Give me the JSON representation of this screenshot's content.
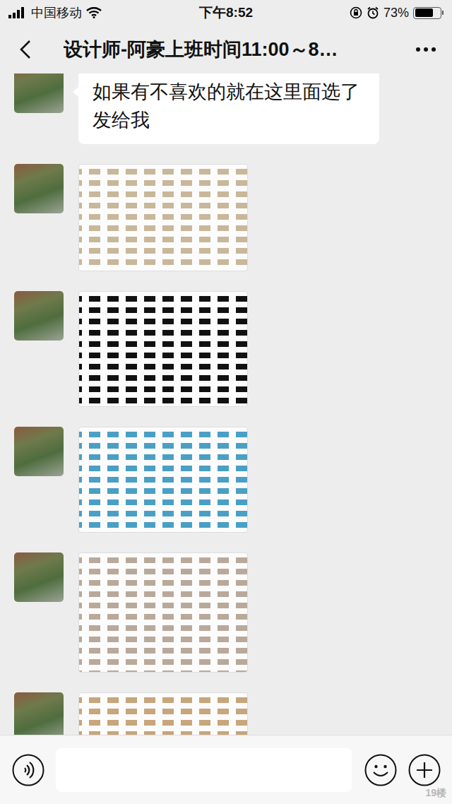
{
  "status_bar": {
    "carrier": "中国移动",
    "time": "下午8:52",
    "battery": "73%",
    "battery_level": 0.73
  },
  "nav": {
    "title": "设计师-阿豪上班时间11:00～8…"
  },
  "messages": [
    {
      "kind": "text",
      "text": "如果有不喜欢的就在这里面选了发给我"
    },
    {
      "kind": "image"
    },
    {
      "kind": "image"
    },
    {
      "kind": "image"
    },
    {
      "kind": "image"
    },
    {
      "kind": "image"
    }
  ],
  "watermark": "19楼"
}
